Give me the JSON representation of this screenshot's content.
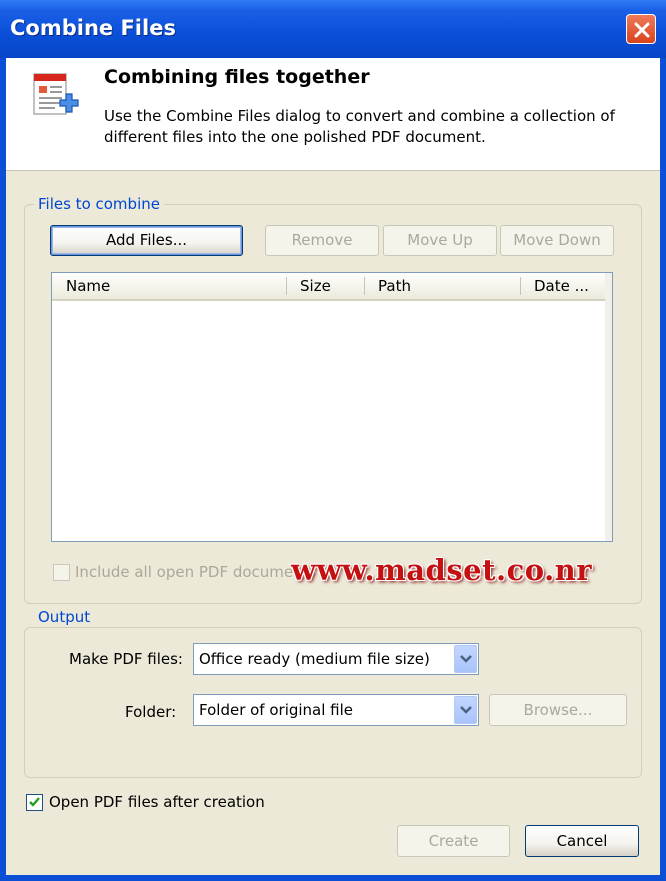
{
  "window": {
    "title": "Combine Files"
  },
  "header": {
    "title": "Combining files together",
    "description": "Use the Combine Files dialog to convert and combine a collection of different files into the one polished PDF document."
  },
  "files_group": {
    "legend": "Files to combine",
    "add_label": "Add Files...",
    "remove_label": "Remove",
    "move_up_label": "Move Up",
    "move_down_label": "Move Down",
    "columns": [
      "Name",
      "Size",
      "Path",
      "Date ..."
    ],
    "rows": [],
    "include_open_label": "Include all open PDF documents",
    "include_open_checked": false
  },
  "watermark": "www.madset.co.nr",
  "output_group": {
    "legend": "Output",
    "make_pdf_label": "Make PDF files:",
    "make_pdf_value": "Office ready (medium file size)",
    "folder_label": "Folder:",
    "folder_value": "Folder of original file",
    "browse_label": "Browse..."
  },
  "footer": {
    "open_after_label": "Open PDF files after creation",
    "open_after_checked": true,
    "create_label": "Create",
    "cancel_label": "Cancel"
  },
  "colors": {
    "titlebar": "#0a4fd8",
    "legend": "#0046d5",
    "watermark": "#c41010",
    "face": "#ece9d8"
  },
  "icons": {
    "header": "combine-files-icon",
    "close": "close-icon",
    "dropdown": "chevron-down-icon",
    "check": "checkmark-icon"
  }
}
